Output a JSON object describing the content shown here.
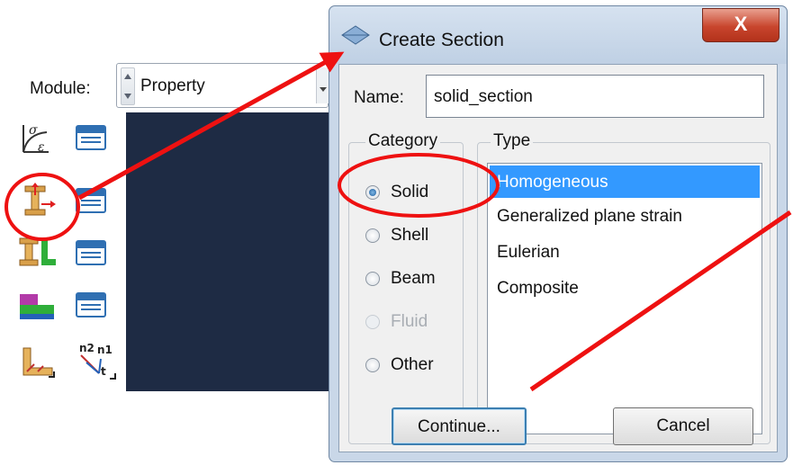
{
  "toolbar": {
    "module_label": "Module:",
    "module_value": "Property"
  },
  "tools": [
    {
      "icon": "stress-strain-material-icon"
    },
    {
      "icon": "material-manager-icon"
    },
    {
      "icon": "create-section-icon"
    },
    {
      "icon": "section-manager-icon"
    },
    {
      "icon": "assign-section-icon"
    },
    {
      "icon": "section-assignment-manager-icon"
    },
    {
      "icon": "create-profile-icon"
    },
    {
      "icon": "profile-manager-icon"
    },
    {
      "icon": "special-assign-icon"
    },
    {
      "icon": "beam-orientation-icon"
    }
  ],
  "dialog": {
    "title": "Create Section",
    "close_label": "X",
    "name_label": "Name:",
    "name_value": "solid_section",
    "category_legend": "Category",
    "type_legend": "Type",
    "categories": [
      {
        "label": "Solid",
        "selected": true,
        "enabled": true
      },
      {
        "label": "Shell",
        "selected": false,
        "enabled": true
      },
      {
        "label": "Beam",
        "selected": false,
        "enabled": true
      },
      {
        "label": "Fluid",
        "selected": false,
        "enabled": false
      },
      {
        "label": "Other",
        "selected": false,
        "enabled": true
      }
    ],
    "types": [
      {
        "label": "Homogeneous",
        "selected": true
      },
      {
        "label": "Generalized plane strain",
        "selected": false
      },
      {
        "label": "Eulerian",
        "selected": false
      },
      {
        "label": "Composite",
        "selected": false
      }
    ],
    "continue_label": "Continue...",
    "cancel_label": "Cancel"
  },
  "colors": {
    "annotation": "#ee1111",
    "selection": "#3399ff",
    "viewport": "#1e2b44"
  }
}
